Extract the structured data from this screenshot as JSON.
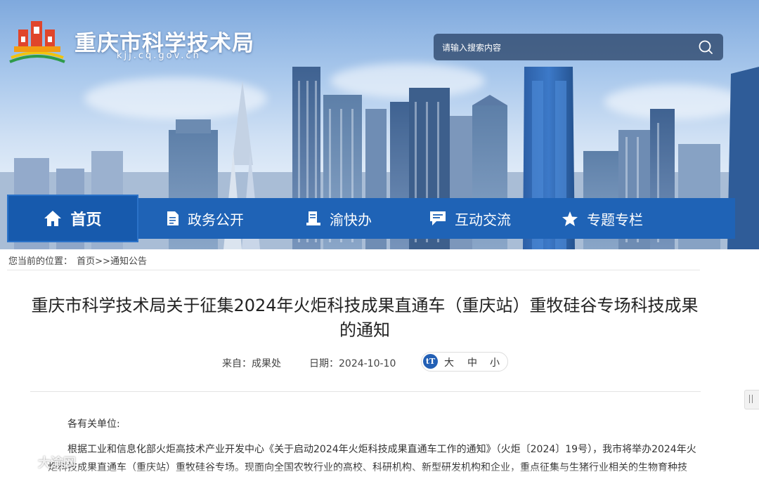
{
  "site": {
    "title": "重庆市科学技术局",
    "domain": "kjj.cq.gov.cn",
    "search_placeholder": "请输入搜索内容"
  },
  "nav": [
    {
      "label": "首页",
      "icon": "home-icon",
      "active": true
    },
    {
      "label": "政务公开",
      "icon": "document-icon",
      "active": false
    },
    {
      "label": "渝快办",
      "icon": "book-icon",
      "active": false
    },
    {
      "label": "互动交流",
      "icon": "chat-icon",
      "active": false
    },
    {
      "label": "专题专栏",
      "icon": "star-icon",
      "active": false
    }
  ],
  "breadcrumb": {
    "prefix": "您当前的位置：",
    "path": "首页>>通知公告"
  },
  "article": {
    "title": "重庆市科学技术局关于征集2024年火炬科技成果直通车（重庆站）重牧硅谷专场科技成果的通知",
    "source": "来自：成果处",
    "date": "日期：2024-10-10",
    "font_size": {
      "large": "大",
      "medium": "中",
      "small": "小"
    },
    "salutation": "各有关单位:",
    "body_lines": [
      "根据工业和信息化部火炬高技术产业开发中心《关于启动2024年火炬科技成果直通车工作的通知》（火炬〔2024〕19号），我市将举办2024年火",
      "炬科技成果直通车（重庆站）重牧硅谷专场。现面向全国农牧行业的高校、科研机构、新型研发机构和企业，重点征集与生猪行业相关的生物育种技"
    ]
  },
  "watermark": "大渝网",
  "colors": {
    "nav_blue": "#1f63b6",
    "nav_active": "#175aad",
    "search_bg": "#233c5f"
  }
}
